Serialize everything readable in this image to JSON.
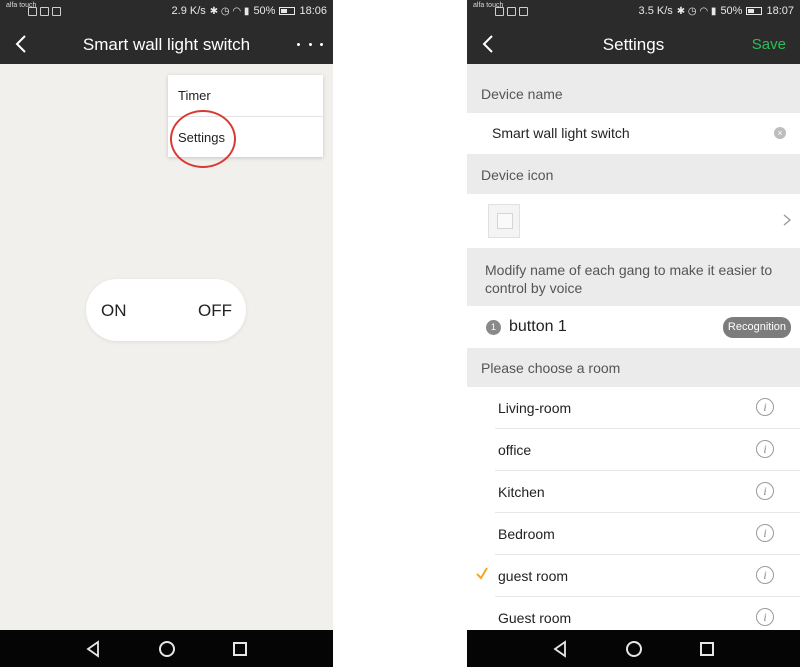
{
  "left": {
    "status": {
      "carrier": "alfa touch",
      "speed": "2.9 K/s",
      "battery": "50%",
      "time": "18:06"
    },
    "title": "Smart wall light switch",
    "menu": {
      "items": [
        "Timer",
        "Settings"
      ]
    },
    "toggle": {
      "on_label": "ON",
      "off_label": "OFF"
    }
  },
  "right": {
    "status": {
      "carrier": "alfa touch",
      "speed": "3.5 K/s",
      "battery": "50%",
      "time": "18:07"
    },
    "title": "Settings",
    "save_label": "Save",
    "device_name": {
      "header": "Device name",
      "value": "Smart wall light switch"
    },
    "device_icon": {
      "header": "Device icon"
    },
    "gang": {
      "header": "Modify name of each gang to make it easier to control by voice",
      "number": "1",
      "name": "button 1",
      "recognition_label": "Recognition"
    },
    "rooms": {
      "header": "Please choose a room",
      "items": [
        {
          "label": "Living-room"
        },
        {
          "label": "office"
        },
        {
          "label": "Kitchen"
        },
        {
          "label": "Bedroom"
        },
        {
          "label": "guest room",
          "selected": true
        },
        {
          "label": "Guest room"
        }
      ]
    }
  },
  "colors": {
    "bar": "#2b2b2b",
    "accent_save": "#2dbd5a",
    "check": "#f5a623",
    "highlight_circle": "#d83a34"
  },
  "icons": [
    "back-icon",
    "more-icon",
    "clear-icon",
    "chevron-right-icon",
    "info-icon",
    "check-icon",
    "nav-back-icon",
    "nav-home-icon",
    "nav-recent-icon"
  ]
}
